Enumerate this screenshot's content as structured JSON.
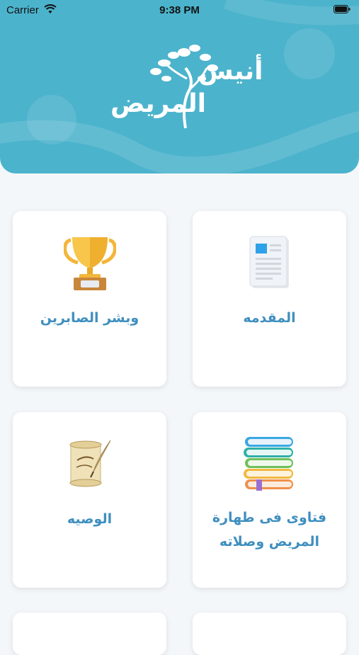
{
  "status_bar": {
    "carrier": "Carrier",
    "time": "9:38 PM"
  },
  "header": {
    "logo_line1": "أنيس",
    "logo_line2": "المريض",
    "background_color": "#4cb3cc"
  },
  "cards": [
    {
      "label": "المقدمه",
      "icon": "document-icon"
    },
    {
      "label": "وبشر الصابرين",
      "icon": "trophy-icon"
    },
    {
      "label_lines": [
        "فتاوى فى طهارة",
        "المريض وصلاته"
      ],
      "icon": "books-icon"
    },
    {
      "label": "الوصيه",
      "icon": "scroll-quill-icon"
    }
  ],
  "accent_color": "#3f8fbf"
}
